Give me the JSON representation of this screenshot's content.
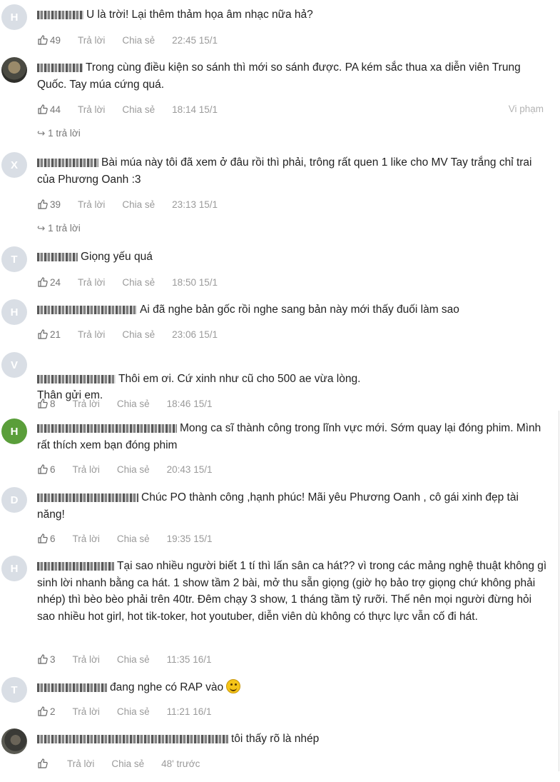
{
  "labels": {
    "reply": "Trả lời",
    "share": "Chia sẻ",
    "report": "Vi phạm"
  },
  "comments": [
    {
      "avatar": "H",
      "text": "U là trời! Lại thêm thảm họa âm nhạc nữa hả?",
      "likes": "49",
      "time": "22:45 15/1"
    },
    {
      "avatar": "",
      "text": "Trong cùng điều kiện so sánh thì mới so sánh được. PA kém sắc thua xa diễn viên Trung Quốc. Tay múa cứng quá.",
      "likes": "44",
      "time": "18:14 15/1",
      "replies": "1 trả lời"
    },
    {
      "avatar": "X",
      "text": "Bài múa này tôi đã xem ở đâu rồi thì phải, trông rất quen 1 like cho MV Tay trắng chỉ trai của Phương Oanh :3",
      "likes": "39",
      "time": "23:13 15/1",
      "replies": "1 trả lời"
    },
    {
      "avatar": "T",
      "text": "Giọng yếu quá",
      "likes": "24",
      "time": "18:50 15/1"
    },
    {
      "avatar": "H",
      "text": "Ai đã nghe bản gốc rồi nghe sang bản này mới thấy đuối làm sao",
      "likes": "21",
      "time": "23:06 15/1"
    },
    {
      "avatar": "V",
      "text": "Thôi em ơi. Cứ xinh như cũ cho 500 ae vừa lòng.\nThân gửi em.",
      "likes": "8",
      "time": "18:46 15/1"
    },
    {
      "avatar": "H",
      "text": "Mong ca sĩ thành công trong lĩnh vực mới. Sớm quay lại đóng phim. Mình rất thích xem bạn đóng phim",
      "likes": "6",
      "time": "20:43 15/1"
    },
    {
      "avatar": "D",
      "text": "Chúc PO thành công ,hạnh phúc! Mãi yêu Phương Oanh , cô gái xinh đẹp tài năng!",
      "likes": "6",
      "time": "19:35 15/1"
    },
    {
      "avatar": "H",
      "text": "Tại sao nhiều người biết 1 tí thì lấn sân ca hát?? vì trong các mảng nghệ thuật không gì sinh lời nhanh bằng ca hát. 1 show tầm 2 bài, mở thu sẵn giọng (giờ họ bảo trợ giọng chứ không phải nhép) thì bèo bèo phải trên 40tr. Đêm chạy 3 show, 1 tháng tầm tỷ rưỡi. Thế nên mọi người đừng hỏi sao nhiều hot girl, hot tik-toker, hot youtuber, diễn viên dù không có thực lực vẫn cố đi hát.",
      "likes": "3",
      "time": "11:35 16/1"
    },
    {
      "avatar": "T",
      "text": "đang nghe có RAP vào",
      "likes": "2",
      "time": "11:21 16/1"
    },
    {
      "avatar": "",
      "text": "tôi thấy rõ là nhép",
      "likes": "",
      "time": "48' trước"
    }
  ]
}
